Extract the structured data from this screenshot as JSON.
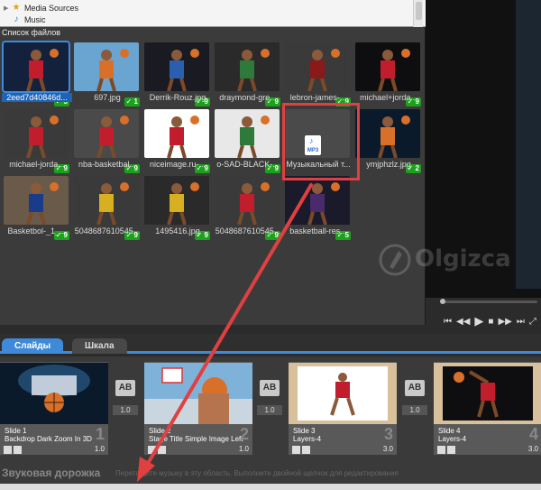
{
  "tree": {
    "items": [
      {
        "label": "Media Sources",
        "icon": "star-icon"
      },
      {
        "label": "Music",
        "icon": "music-note-icon"
      }
    ]
  },
  "file_panel": {
    "title": "Список файлов",
    "files": [
      {
        "name": "2eed7d40846d...",
        "badge": "5",
        "selected": true
      },
      {
        "name": "697.jpg",
        "badge": "1"
      },
      {
        "name": "Derrik-Rouz.jpg",
        "badge": "9"
      },
      {
        "name": "draymond-gre...",
        "badge": "9"
      },
      {
        "name": "lebron-james-...",
        "badge": "9"
      },
      {
        "name": "michael+jorda...",
        "badge": "9"
      },
      {
        "name": "michael-jorda...",
        "badge": "9"
      },
      {
        "name": "nba-basketbal...",
        "badge": "9"
      },
      {
        "name": "niceimage.ru-...",
        "badge": "9"
      },
      {
        "name": "o-SAD-BLACK-...",
        "badge": "9"
      },
      {
        "name": "Музыкальный т...",
        "badge": "",
        "type": "mp3"
      },
      {
        "name": "ymjphzlz.jpg",
        "badge": "2"
      },
      {
        "name": "Basketbol-_1_...",
        "badge": "9"
      },
      {
        "name": "5048687610545...",
        "badge": "9"
      },
      {
        "name": "1495416.jpg",
        "badge": "9"
      },
      {
        "name": "5048687610545...",
        "badge": "9"
      },
      {
        "name": "basketball-res...",
        "badge": "5"
      }
    ],
    "mp3_label": "MP3"
  },
  "watermark": "Olgizca",
  "tabs": [
    {
      "label": "Слайды",
      "active": true
    },
    {
      "label": "Шкала",
      "active": false
    }
  ],
  "slides": [
    {
      "title": "Slide 1",
      "subtitle": "Backdrop Dark Zoom In 3D",
      "number": "1",
      "duration": "1.0"
    },
    {
      "title": "Slide 2",
      "subtitle": "Stage Title Simple Image Left",
      "number": "2",
      "duration": "1.0"
    },
    {
      "title": "Slide 3",
      "subtitle": "Layers-4",
      "number": "3",
      "duration": "3.0"
    },
    {
      "title": "Slide 4",
      "subtitle": "Layers-4",
      "number": "4",
      "duration": "3.0"
    }
  ],
  "transitions": [
    {
      "label": "AB",
      "duration": "1.0"
    },
    {
      "label": "AB",
      "duration": "1.0"
    },
    {
      "label": "AB",
      "duration": "1.0"
    }
  ],
  "soundtrack": {
    "title": "Звуковая дорожка",
    "hint": "Перетащите музыку в эту область. Выполните двойной щелчок для редактирования"
  },
  "colors": {
    "accent": "#3e8ad8",
    "badge": "#1da11d",
    "annotation": "#e04040"
  }
}
